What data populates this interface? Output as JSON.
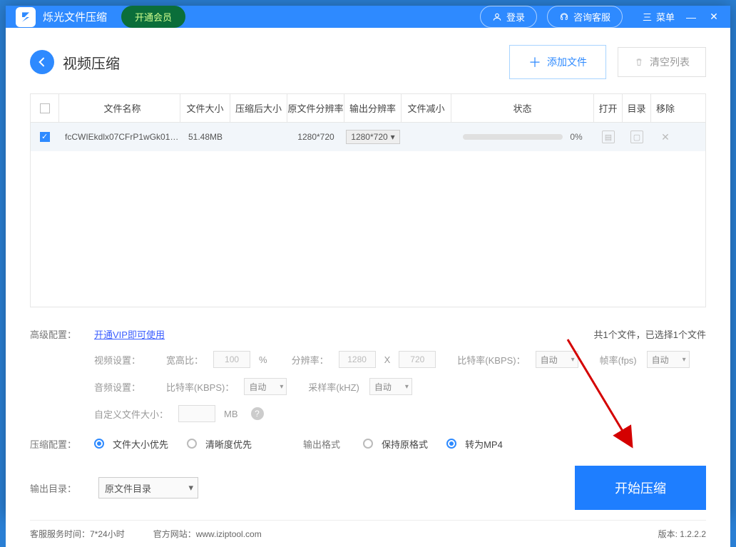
{
  "titlebar": {
    "app_name": "烁光文件压缩",
    "vip_label": "开通会员",
    "login_label": "登录",
    "support_label": "咨询客服",
    "menu_label": "菜单"
  },
  "header": {
    "page_title": "视频压缩",
    "add_file": "添加文件",
    "clear_list": "清空列表"
  },
  "table": {
    "cols": {
      "name": "文件名称",
      "size": "文件大小",
      "compressed_size": "压缩后大小",
      "orig_res": "原文件分辨率",
      "out_res": "输出分辨率",
      "reduce": "文件减小",
      "status": "状态",
      "open": "打开",
      "dir": "目录",
      "remove": "移除"
    },
    "rows": [
      {
        "name": "fcCWIEkdlx07CFrP1wGk010...",
        "size": "51.48MB",
        "orig_res": "1280*720",
        "out_res": "1280*720",
        "pct": "0%"
      }
    ]
  },
  "config": {
    "advanced_label": "高级配置：",
    "vip_link": "开通VIP即可使用",
    "file_count": "共1个文件，已选择1个文件",
    "video_settings": "视频设置：",
    "aspect": "宽高比：",
    "aspect_val": "100",
    "aspect_unit": "%",
    "resolution": "分辨率：",
    "res_w": "1280",
    "res_h": "720",
    "bitrate": "比特率(KBPS)：",
    "bitrate_val": "自动",
    "fps": "帧率(fps)",
    "fps_val": "自动",
    "audio_settings": "音频设置：",
    "audio_bitrate": "比特率(KBPS)：",
    "audio_bitrate_val": "自动",
    "sample": "采样率(kHZ)",
    "sample_val": "自动",
    "custom_size": "自定义文件大小：",
    "custom_unit": "MB",
    "compress_cfg": "压缩配置：",
    "radios": {
      "size_first": "文件大小优先",
      "clarity_first": "清晰度优先",
      "out_format": "输出格式",
      "keep_format": "保持原格式",
      "to_mp4": "转为MP4"
    },
    "output_dir_label": "输出目录：",
    "output_dir_val": "原文件目录",
    "start": "开始压缩"
  },
  "footer": {
    "service": "客服服务时间：7*24小时",
    "site": "官方网站：www.iziptool.com",
    "version": "版本: 1.2.2.2"
  }
}
